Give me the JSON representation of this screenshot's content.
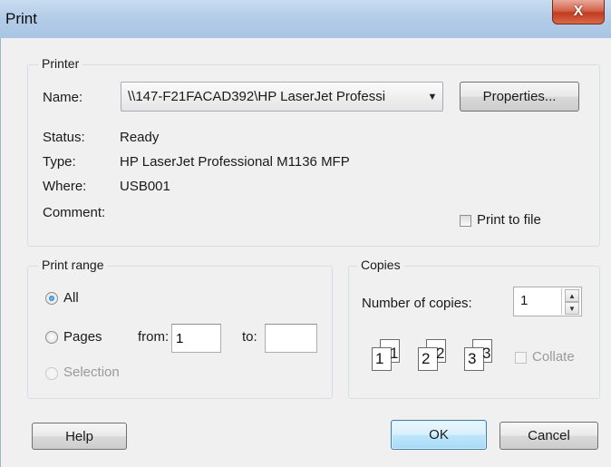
{
  "window": {
    "title": "Print",
    "close_symbol": "X"
  },
  "printer": {
    "group_label": "Printer",
    "name_label": "Name:",
    "name_value": "\\\\147-F21FACAD392\\HP LaserJet Professi",
    "properties_button": "Properties...",
    "status_label": "Status:",
    "status_value": "Ready",
    "type_label": "Type:",
    "type_value": "HP LaserJet Professional M1136 MFP",
    "where_label": "Where:",
    "where_value": "USB001",
    "comment_label": "Comment:",
    "print_to_file_label": "Print to file",
    "print_to_file_checked": false
  },
  "print_range": {
    "group_label": "Print range",
    "all_label": "All",
    "all_selected": true,
    "pages_label": "Pages",
    "from_label": "from:",
    "from_value": "1",
    "to_label": "to:",
    "to_value": "",
    "selection_label": "Selection",
    "selection_enabled": false
  },
  "copies": {
    "group_label": "Copies",
    "number_label": "Number of copies:",
    "number_value": "1",
    "collate_label": "Collate",
    "collate_enabled": false,
    "collate_icon_pages": [
      "1",
      "1",
      "2",
      "2",
      "3",
      "3"
    ]
  },
  "buttons": {
    "help": "Help",
    "ok": "OK",
    "cancel": "Cancel"
  },
  "icons": {
    "close": "close-icon",
    "dropdown": "chevron-down-icon",
    "spin_up": "spin-up-icon",
    "spin_down": "spin-down-icon"
  }
}
